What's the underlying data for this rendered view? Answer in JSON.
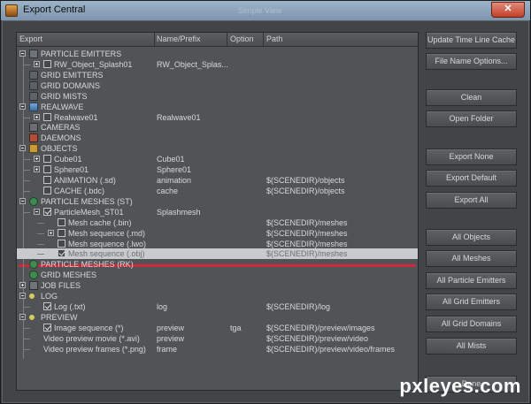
{
  "window": {
    "title": "Export Central",
    "ghost_title": "Simple View",
    "close_glyph": "✕"
  },
  "columns": [
    "Export",
    "Name/Prefix",
    "Option",
    "Path"
  ],
  "rows": [
    {
      "label": "PARTICLE EMITTERS",
      "name": "",
      "option": "",
      "path": "",
      "expander": "minus",
      "icon": "particle-emitter-icon",
      "checkbox": null,
      "selected": false
    },
    {
      "label": "RW_Object_Splash01",
      "name": "RW_Object_Splas...",
      "option": "",
      "path": "",
      "expander": "plus",
      "icon": null,
      "checkbox": false,
      "selected": false
    },
    {
      "label": "GRID EMITTERS",
      "name": "",
      "option": "",
      "path": "",
      "expander": null,
      "icon": "grid-emitter-icon",
      "checkbox": null,
      "selected": false
    },
    {
      "label": "GRID DOMAINS",
      "name": "",
      "option": "",
      "path": "",
      "expander": null,
      "icon": "grid-domain-icon",
      "checkbox": null,
      "selected": false
    },
    {
      "label": "GRID MISTS",
      "name": "",
      "option": "",
      "path": "",
      "expander": null,
      "icon": "grid-mist-icon",
      "checkbox": null,
      "selected": false
    },
    {
      "label": "REALWAVE",
      "name": "",
      "option": "",
      "path": "",
      "expander": "minus",
      "icon": "realwave-icon",
      "checkbox": null,
      "selected": false
    },
    {
      "label": "Realwave01",
      "name": "Realwave01",
      "option": "",
      "path": "",
      "expander": "plus",
      "icon": null,
      "checkbox": false,
      "selected": false
    },
    {
      "label": "CAMERAS",
      "name": "",
      "option": "",
      "path": "",
      "expander": null,
      "icon": "camera-icon",
      "checkbox": null,
      "selected": false
    },
    {
      "label": "DAEMONS",
      "name": "",
      "option": "",
      "path": "",
      "expander": null,
      "icon": "daemon-icon",
      "checkbox": null,
      "selected": false
    },
    {
      "label": "OBJECTS",
      "name": "",
      "option": "",
      "path": "",
      "expander": "minus",
      "icon": "object-icon",
      "checkbox": null,
      "selected": false
    },
    {
      "label": "Cube01",
      "name": "Cube01",
      "option": "",
      "path": "",
      "expander": "plus",
      "icon": null,
      "checkbox": false,
      "selected": false
    },
    {
      "label": "Sphere01",
      "name": "Sphere01",
      "option": "",
      "path": "",
      "expander": "plus",
      "icon": null,
      "checkbox": false,
      "selected": false
    },
    {
      "label": "ANIMATION (.sd)",
      "name": "animation",
      "option": "",
      "path": "$(SCENEDIR)/objects",
      "expander": null,
      "icon": null,
      "checkbox": false,
      "selected": false
    },
    {
      "label": "CACHE (.bdc)",
      "name": "cache",
      "option": "",
      "path": "$(SCENEDIR)/objects",
      "expander": null,
      "icon": null,
      "checkbox": false,
      "selected": false
    },
    {
      "label": "PARTICLE MESHES (ST)",
      "name": "",
      "option": "",
      "path": "",
      "expander": "minus",
      "icon": "particle-mesh-icon",
      "checkbox": null,
      "selected": false
    },
    {
      "label": "ParticleMesh_ST01",
      "name": "Splashmesh",
      "option": "",
      "path": "",
      "expander": "minus",
      "icon": null,
      "checkbox": true,
      "selected": false
    },
    {
      "label": "Mesh cache (.bin)",
      "name": "",
      "option": "",
      "path": "$(SCENEDIR)/meshes",
      "expander": null,
      "icon": null,
      "checkbox": false,
      "selected": false
    },
    {
      "label": "Mesh sequence (.md)",
      "name": "",
      "option": "",
      "path": "$(SCENEDIR)/meshes",
      "expander": "plus",
      "icon": null,
      "checkbox": false,
      "selected": false
    },
    {
      "label": "Mesh sequence (.lwo)",
      "name": "",
      "option": "",
      "path": "$(SCENEDIR)/meshes",
      "expander": null,
      "icon": null,
      "checkbox": false,
      "selected": false
    },
    {
      "label": "Mesh sequence (.obj)",
      "name": "",
      "option": "",
      "path": "$(SCENEDIR)/meshes",
      "expander": null,
      "icon": null,
      "checkbox": true,
      "selected": true
    },
    {
      "label": "PARTICLE MESHES (RK)",
      "name": "",
      "option": "",
      "path": "",
      "expander": null,
      "icon": "particle-mesh-icon",
      "checkbox": null,
      "selected": false
    },
    {
      "label": "GRID MESHES",
      "name": "",
      "option": "",
      "path": "",
      "expander": null,
      "icon": "grid-mesh-icon",
      "checkbox": null,
      "selected": false
    },
    {
      "label": "JOB FILES",
      "name": "",
      "option": "",
      "path": "",
      "expander": "plus",
      "icon": "job-file-icon",
      "checkbox": null,
      "selected": false
    },
    {
      "label": "LOG",
      "name": "",
      "option": "",
      "path": "",
      "expander": "minus",
      "icon": "log-icon",
      "checkbox": null,
      "selected": false
    },
    {
      "label": "Log (.txt)",
      "name": "log",
      "option": "",
      "path": "$(SCENEDIR)/log",
      "expander": null,
      "icon": null,
      "checkbox": true,
      "selected": false
    },
    {
      "label": "PREVIEW",
      "name": "",
      "option": "",
      "path": "",
      "expander": "minus",
      "icon": "preview-icon",
      "checkbox": null,
      "selected": false
    },
    {
      "label": "Image sequence (*)",
      "name": "preview",
      "option": "tga",
      "path": "$(SCENEDIR)/preview/images",
      "expander": null,
      "icon": null,
      "checkbox": true,
      "selected": false
    },
    {
      "label": "Video preview movie (*.avi)",
      "name": "preview",
      "option": "",
      "path": "$(SCENEDIR)/preview/video",
      "expander": null,
      "icon": null,
      "checkbox": null,
      "selected": false
    },
    {
      "label": "Video preview frames (*.png)",
      "name": "frame",
      "option": "",
      "path": "$(SCENEDIR)/preview/video/frames",
      "expander": null,
      "icon": null,
      "checkbox": null,
      "selected": false
    }
  ],
  "buttons": [
    {
      "label": "Update Time Line Cache"
    },
    {
      "label": "File Name Options..."
    },
    {
      "label": "Clean"
    },
    {
      "label": "Open Folder"
    },
    {
      "label": "Export None"
    },
    {
      "label": "Export Default"
    },
    {
      "label": "Export All"
    },
    {
      "label": "All Objects"
    },
    {
      "label": "All Meshes"
    },
    {
      "label": "All Particle Emitters"
    },
    {
      "label": "All Grid Emitters"
    },
    {
      "label": "All Grid Domains"
    },
    {
      "label": "All Mists"
    },
    {
      "label": "Done"
    }
  ],
  "watermark": "pxleyes.com",
  "colors": {
    "selection": "#c8cacb",
    "highlight": "#d0273a"
  }
}
